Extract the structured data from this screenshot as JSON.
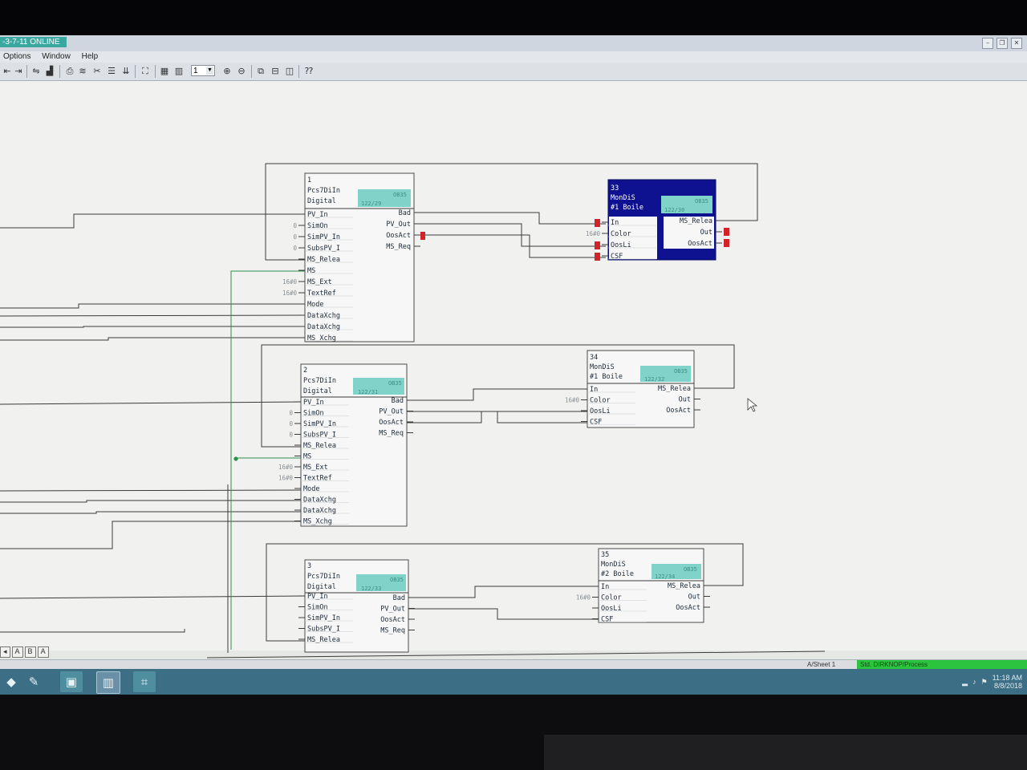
{
  "window": {
    "title": "-3-7-11 ONLINE",
    "menu": [
      "Options",
      "Window",
      "Help"
    ],
    "zoom_value": "1"
  },
  "blocks": [
    {
      "number": "1",
      "type": "Pcs7DiIn",
      "comment": "Digital",
      "badge": "OB35",
      "runseq": "122/29",
      "inputs": [
        {
          "label": "PV_In",
          "value": ""
        },
        {
          "label": "SimOn",
          "value": "0"
        },
        {
          "label": "SimPV_In",
          "value": "0"
        },
        {
          "label": "SubsPV_I",
          "value": "0"
        },
        {
          "label": "MS_Relea",
          "value": ""
        },
        {
          "label": "MS",
          "value": ""
        },
        {
          "label": "MS_Ext",
          "value": "16#0"
        },
        {
          "label": "TextRef",
          "value": "16#0"
        },
        {
          "label": "Mode",
          "value": ""
        },
        {
          "label": "DataXchg",
          "value": ""
        },
        {
          "label": "DataXchg",
          "value": ""
        },
        {
          "label": "MS_Xchg",
          "value": ""
        }
      ],
      "outputs": [
        "Bad",
        "PV_Out",
        "OosAct",
        "MS_Req"
      ]
    },
    {
      "number": "2",
      "type": "Pcs7DiIn",
      "comment": "Digital",
      "badge": "OB35",
      "runseq": "122/31",
      "inputs": [
        {
          "label": "PV_In",
          "value": ""
        },
        {
          "label": "SimOn",
          "value": "0"
        },
        {
          "label": "SimPV_In",
          "value": "0"
        },
        {
          "label": "SubsPV_I",
          "value": "0"
        },
        {
          "label": "MS_Relea",
          "value": ""
        },
        {
          "label": "MS",
          "value": ""
        },
        {
          "label": "MS_Ext",
          "value": "16#0"
        },
        {
          "label": "TextRef",
          "value": "16#0"
        },
        {
          "label": "Mode",
          "value": ""
        },
        {
          "label": "DataXchg",
          "value": ""
        },
        {
          "label": "DataXchg",
          "value": ""
        },
        {
          "label": "MS_Xchg",
          "value": ""
        }
      ],
      "outputs": [
        "Bad",
        "PV_Out",
        "OosAct",
        "MS_Req"
      ]
    },
    {
      "number": "3",
      "type": "Pcs7DiIn",
      "comment": "Digital",
      "badge": "OB35",
      "runseq": "122/33",
      "inputs": [
        {
          "label": "PV_In",
          "value": ""
        },
        {
          "label": "SimOn",
          "value": ""
        },
        {
          "label": "SimPV_In",
          "value": ""
        },
        {
          "label": "SubsPV_I",
          "value": ""
        },
        {
          "label": "MS_Relea",
          "value": ""
        }
      ],
      "outputs": [
        "Bad",
        "PV_Out",
        "OosAct",
        "MS_Req"
      ]
    },
    {
      "number": "33",
      "type": "MonDiS",
      "comment": "#1 Boile",
      "badge": "OB35",
      "runseq": "122/30",
      "inputs": [
        {
          "label": "In",
          "value": ""
        },
        {
          "label": "Color",
          "value": "16#0"
        },
        {
          "label": "OosLi",
          "value": ""
        },
        {
          "label": "CSF",
          "value": ""
        }
      ],
      "outputs": [
        "MS_Relea",
        "Out",
        "OosAct"
      ]
    },
    {
      "number": "34",
      "type": "MonDiS",
      "comment": "#1 Boile",
      "badge": "OB35",
      "runseq": "122/32",
      "inputs": [
        {
          "label": "In",
          "value": ""
        },
        {
          "label": "Color",
          "value": "16#0"
        },
        {
          "label": "OosLi",
          "value": ""
        },
        {
          "label": "CSF",
          "value": ""
        }
      ],
      "outputs": [
        "MS_Relea",
        "Out",
        "OosAct"
      ]
    },
    {
      "number": "35",
      "type": "MonDiS",
      "comment": "#2 Boile",
      "badge": "OB35",
      "runseq": "122/34",
      "inputs": [
        {
          "label": "In",
          "value": ""
        },
        {
          "label": "Color",
          "value": "16#0"
        },
        {
          "label": "OosLi",
          "value": ""
        },
        {
          "label": "CSF",
          "value": ""
        }
      ],
      "outputs": [
        "MS_Relea",
        "Out",
        "OosAct"
      ]
    }
  ],
  "sheet_tabs": [
    "A",
    "B",
    "A"
  ],
  "status": {
    "sheet": "A/Sheet 1",
    "online": "Std. DIRKNOP/Process"
  },
  "colors": {
    "selected_block": "#0f1290",
    "badge": "#7fd3c9",
    "online_status": "#2cc43f",
    "error_marker": "#d4222a",
    "cross_sheet_wire": "#2e8f4a"
  },
  "icons": {
    "taskbar": [
      "simatic-manager-icon",
      "spreadsheet-icon",
      "cfc-editor-icon",
      "network-config-icon"
    ]
  },
  "clock": {
    "time": "11:18 AM",
    "date": "8/8/2018"
  }
}
